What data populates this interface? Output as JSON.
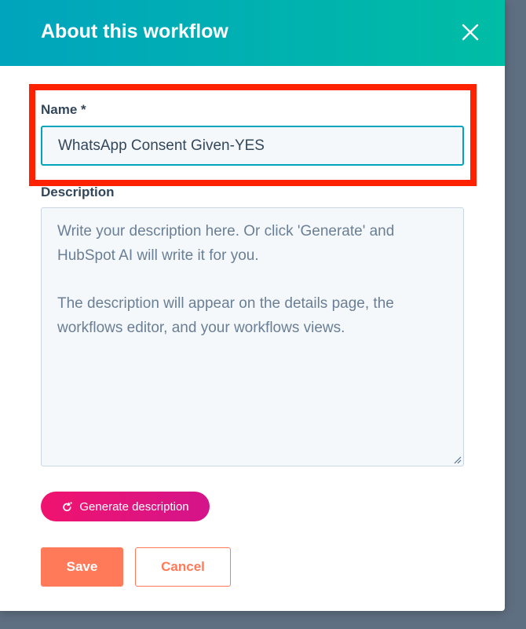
{
  "modal": {
    "title": "About this workflow",
    "close_icon": "close-icon"
  },
  "name_field": {
    "label": "Name *",
    "value": "WhatsApp Consent Given-YES"
  },
  "description_field": {
    "label": "Description",
    "placeholder_lines": [
      "Write your description here. Or click 'Generate' and",
      "HubSpot AI will write it for you.",
      "",
      "The description will appear on the details page, the",
      "workflows editor, and your workflows views."
    ]
  },
  "generate_button": {
    "label": "Generate description",
    "icon": "ai-refresh-icon"
  },
  "actions": {
    "save_label": "Save",
    "cancel_label": "Cancel"
  },
  "colors": {
    "header_start": "#00a4bd",
    "header_end": "#00bda5",
    "accent": "#ff7a59",
    "generate_start": "#f0136f",
    "generate_end": "#d4148a",
    "highlight": "#ff2200"
  }
}
